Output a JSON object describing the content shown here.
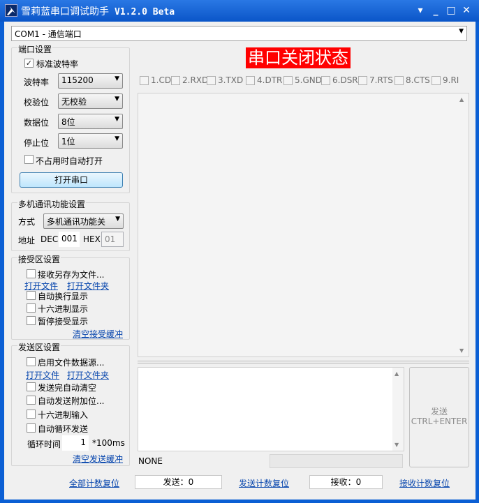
{
  "window": {
    "title": "雪莉蓝串口调试助手",
    "version": "V1.2.0 Beta",
    "controls": {
      "menu": "▾",
      "minimize": "_",
      "maximize": "□",
      "close": "✕"
    }
  },
  "port_select": {
    "value": "COM1 - 通信端口"
  },
  "port_settings": {
    "title": "端口设置",
    "std_baud_label": "标准波特率",
    "std_baud_checked": true,
    "baud_label": "波特率",
    "baud_value": "115200",
    "parity_label": "校验位",
    "parity_value": "无校验",
    "databits_label": "数据位",
    "databits_value": "8位",
    "stopbits_label": "停止位",
    "stopbits_value": "1位",
    "auto_open_label": "不占用时自动打开",
    "open_button": "打开串口"
  },
  "multi": {
    "title": "多机通讯功能设置",
    "mode_label": "方式",
    "mode_value": "多机通讯功能关",
    "addr_label": "地址",
    "dec_label": "DEC",
    "dec_value": "001",
    "hex_label": "HEX",
    "hex_value": "01"
  },
  "receive": {
    "title": "接受区设置",
    "save_to_file": "接收另存为文件...",
    "open_file": "打开文件",
    "open_folder": "打开文件夹",
    "auto_wrap": "自动换行显示",
    "hex_display": "十六进制显示",
    "pause": "暂停接受显示",
    "clear": "清空接受缓冲"
  },
  "send": {
    "title": "发送区设置",
    "file_source": "启用文件数据源...",
    "open_file": "打开文件",
    "open_folder": "打开文件夹",
    "auto_clear": "发送完自动清空",
    "append": "自动发送附加位...",
    "hex_input": "十六进制输入",
    "loop": "自动循环发送",
    "interval_label": "循环时间",
    "interval_value": "1",
    "interval_unit": "*100ms",
    "clear": "清空发送缓冲"
  },
  "status_banner": "串口关闭状态",
  "pins": [
    "1.CD",
    "2.RXD",
    "3.TXD",
    "4.DTR",
    "5.GND",
    "6.DSR",
    "7.RTS",
    "8.CTS",
    "9.RI"
  ],
  "send_button": {
    "line1": "发送",
    "line2": "CTRL+ENTER"
  },
  "append_status": "NONE",
  "bottom": {
    "reset_all": "全部计数复位",
    "sent_label": "发送：0",
    "reset_sent": "发送计数复位",
    "recv_label": "接收：0",
    "reset_recv": "接收计数复位"
  },
  "colors": {
    "titlebar": "#0a55c8",
    "banner": "#ff0000",
    "link": "#0645ad"
  }
}
